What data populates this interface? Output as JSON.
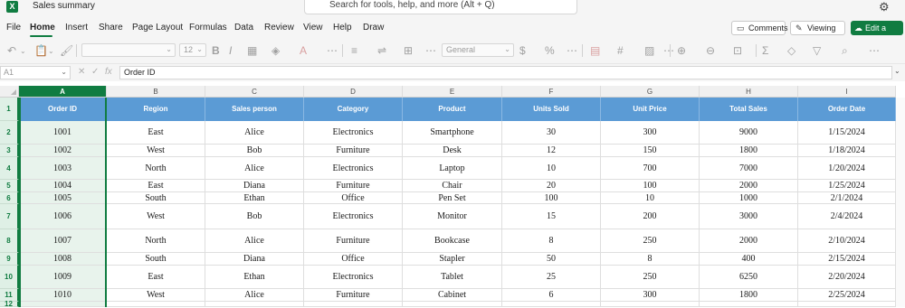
{
  "title_bar": {
    "app_icon": "excel-icon",
    "doc_title": "Sales summary",
    "search_placeholder": "Search for tools, help, and more (Alt + Q)"
  },
  "menu": {
    "items": [
      "File",
      "Home",
      "Insert",
      "Share",
      "Page Layout",
      "Formulas",
      "Data",
      "Review",
      "View",
      "Help",
      "Draw"
    ],
    "active": "Home"
  },
  "actions": {
    "comments": "Comments",
    "viewing": "Viewing",
    "edit_copy": "Edit a copy"
  },
  "ribbon": {
    "font_size": "12",
    "number_format": "General"
  },
  "formula_bar": {
    "name_box": "A1",
    "content": "Order ID"
  },
  "columns": [
    "A",
    "B",
    "C",
    "D",
    "E",
    "F",
    "G",
    "H",
    "I"
  ],
  "selected_column": "A",
  "table": {
    "headers": [
      "Order ID",
      "Region",
      "Sales person",
      "Category",
      "Product",
      "Units Sold",
      "Unit Price",
      "Total Sales",
      "Order Date"
    ],
    "rows": [
      [
        "1001",
        "East",
        "Alice",
        "Electronics",
        "Smartphone",
        "30",
        "300",
        "9000",
        "1/15/2024"
      ],
      [
        "1002",
        "West",
        "Bob",
        "Furniture",
        "Desk",
        "12",
        "150",
        "1800",
        "1/18/2024"
      ],
      [
        "1003",
        "North",
        "Alice",
        "Electronics",
        "Laptop",
        "10",
        "700",
        "7000",
        "1/20/2024"
      ],
      [
        "1004",
        "East",
        "Diana",
        "Furniture",
        "Chair",
        "20",
        "100",
        "2000",
        "1/25/2024"
      ],
      [
        "1005",
        "South",
        "Ethan",
        "Office",
        "Pen Set",
        "100",
        "10",
        "1000",
        "2/1/2024"
      ],
      [
        "1006",
        "West",
        "Bob",
        "Electronics",
        "Monitor",
        "15",
        "200",
        "3000",
        "2/4/2024"
      ],
      [
        "1007",
        "North",
        "Alice",
        "Furniture",
        "Bookcase",
        "8",
        "250",
        "2000",
        "2/10/2024"
      ],
      [
        "1008",
        "South",
        "Diana",
        "Office",
        "Stapler",
        "50",
        "8",
        "400",
        "2/15/2024"
      ],
      [
        "1009",
        "East",
        "Ethan",
        "Electronics",
        "Tablet",
        "25",
        "250",
        "6250",
        "2/20/2024"
      ],
      [
        "1010",
        "West",
        "Alice",
        "Furniture",
        "Cabinet",
        "6",
        "300",
        "1800",
        "2/25/2024"
      ]
    ],
    "row_numbers": [
      "1",
      "2",
      "3",
      "4",
      "5",
      "6",
      "7",
      "8",
      "9",
      "10",
      "11",
      "12"
    ]
  },
  "colors": {
    "accent_green": "#107c41",
    "header_blue": "#5b9bd5",
    "selection_tint": "#e8f3ec"
  }
}
